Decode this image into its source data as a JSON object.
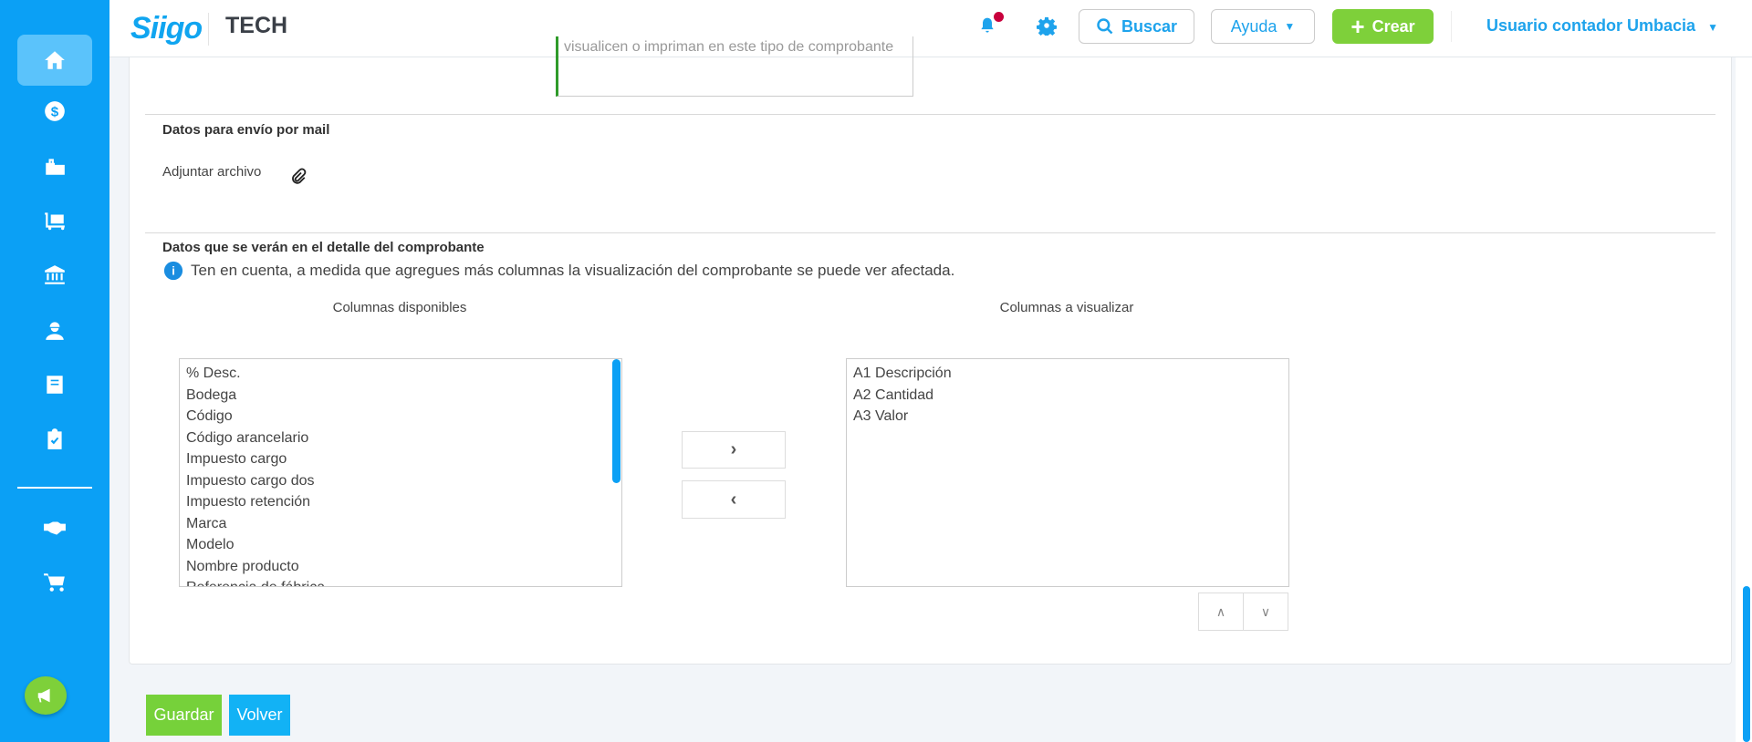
{
  "header": {
    "logo": "Siigo",
    "company": "TECH",
    "search_label": "Buscar",
    "help_label": "Ayuda",
    "create_label": "Crear",
    "user_label": "Usuario contador Umbacia"
  },
  "sidebar": {
    "items": [
      {
        "icon": "home-icon"
      },
      {
        "icon": "dollar-icon"
      },
      {
        "icon": "shopping-bag-icon"
      },
      {
        "icon": "dolly-icon"
      },
      {
        "icon": "bank-icon"
      },
      {
        "icon": "worker-icon"
      },
      {
        "icon": "book-icon"
      },
      {
        "icon": "clipboard-check-icon"
      },
      {
        "icon": "handshake-icon"
      },
      {
        "icon": "cart-icon"
      }
    ]
  },
  "form": {
    "textarea_text": "visualicen o impriman en este tipo de comprobante",
    "mail_section_title": "Datos para envío por mail",
    "attach_label": "Adjuntar archivo",
    "detail_section_title": "Datos que se verán en el detalle del comprobante",
    "info_text": "Ten en cuenta, a medida que agregues más columnas la visualización del comprobante se puede ver afectada.",
    "available_title": "Columnas disponibles",
    "visible_title": "Columnas a visualizar",
    "available_columns": [
      "% Desc.",
      "Bodega",
      "Código",
      "Código arancelario",
      "Impuesto cargo",
      "Impuesto cargo dos",
      "Impuesto retención",
      "Marca",
      "Modelo",
      "Nombre producto",
      "Referencia de fábrica"
    ],
    "visible_columns": [
      "A1 Descripción",
      "A2 Cantidad",
      "A3 Valor"
    ]
  },
  "footer": {
    "save_label": "Guardar",
    "back_label": "Volver"
  },
  "colors": {
    "brand": "#0ba0f5",
    "success": "#7ed03a"
  }
}
